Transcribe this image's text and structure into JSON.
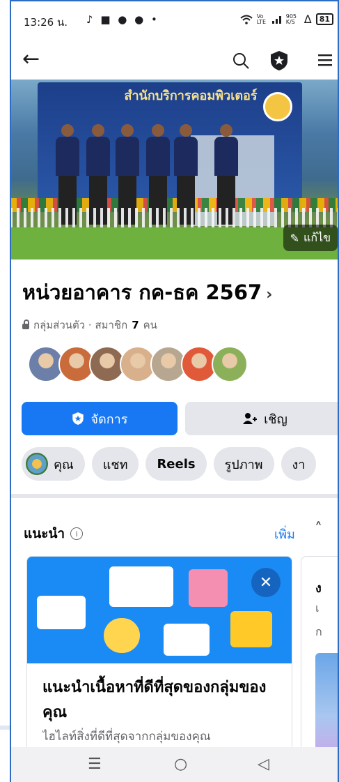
{
  "status_bar": {
    "time": "13:26 น.",
    "app_icons": "♪ ■ ● ● •",
    "network": "Vo LTE",
    "speed": "905 K/S",
    "battery": "81"
  },
  "top_nav": {
    "back_icon": "arrow-left",
    "search_icon": "search",
    "admin_icon": "shield-star",
    "menu_icon": "hamburger"
  },
  "cover": {
    "banner_text": "สำนักบริการคอมพิวเตอร์",
    "edit_label": "แก้ไข"
  },
  "group": {
    "name": "หน่วยอาคาร กค-ธค 2567",
    "privacy": "กลุ่มส่วนตัว · สมาชิก",
    "member_count": "7",
    "member_unit": "คน"
  },
  "members": [
    {
      "color": "#6b7fa8"
    },
    {
      "color": "#c96b3a"
    },
    {
      "color": "#8f6a52"
    },
    {
      "color": "#d9b08c"
    },
    {
      "color": "#b7a690"
    },
    {
      "color": "#e05a3a"
    },
    {
      "color": "#8cb05a"
    }
  ],
  "actions": {
    "manage_label": "จัดการ",
    "invite_label": "เชิญ"
  },
  "chips": [
    {
      "label": "คุณ",
      "has_avatar": true
    },
    {
      "label": "แชท",
      "has_avatar": false
    },
    {
      "label": "Reels",
      "has_avatar": false
    },
    {
      "label": "รูปภาพ",
      "has_avatar": false
    },
    {
      "label": "งา",
      "has_avatar": false
    }
  ],
  "suggested": {
    "heading": "แนะนำ",
    "more_label": "เพิ่ม",
    "card": {
      "title": "แนะนำเนื้อหาที่ดีที่สุดของกลุ่มของคุณ",
      "subtitle": "ไฮไลท์สิ่งที่ดีที่สุดจากกลุ่มของคุณ"
    },
    "card2": {
      "title": "ง",
      "line1": "เ",
      "line2": "ก"
    }
  },
  "colors": {
    "primary": "#1877f2",
    "button_gray": "#e4e6eb",
    "text_secondary": "#65676b"
  }
}
